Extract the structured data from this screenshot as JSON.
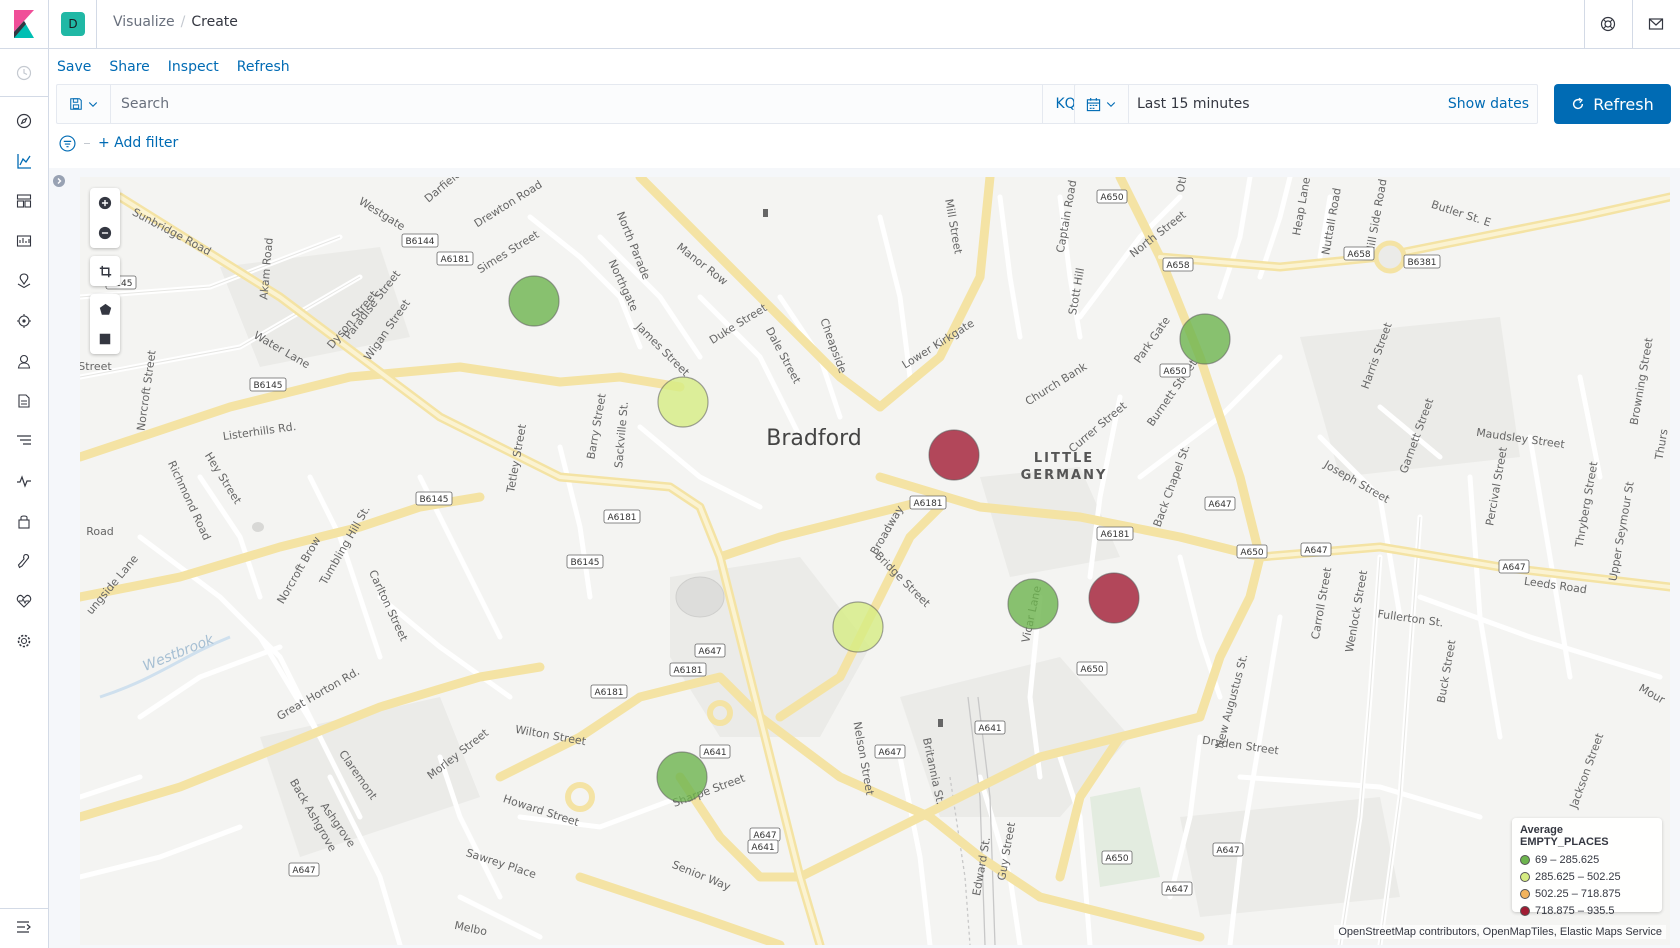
{
  "header": {
    "space_initial": "D",
    "breadcrumbs": [
      "Visualize",
      "Create"
    ]
  },
  "topmenu": {
    "save": "Save",
    "share": "Share",
    "inspect": "Inspect",
    "refresh": "Refresh"
  },
  "query": {
    "placeholder": "Search",
    "language": "KQL"
  },
  "time": {
    "label": "Last 15 minutes",
    "show_dates": "Show dates",
    "refresh_button": "Refresh"
  },
  "filter": {
    "add_filter": "+ Add filter"
  },
  "map": {
    "city_label": "Bradford",
    "district_label_line1": "LITTLE",
    "district_label_line2": "GERMANY",
    "area_label": "Westbrook",
    "street_labels": [
      "Sunbridge Road",
      "Westgate",
      "Drewton Road",
      "Darfield",
      "Simes Street",
      "North Parade",
      "Manor Row",
      "Northgate",
      "Duke Street",
      "Dale Street",
      "Cheapside",
      "James Street",
      "Barry Street",
      "Sackville St.",
      "Lower Kirkgate",
      "Church Bank",
      "Currer Street",
      "Burnett Street",
      "Park Gate",
      "North Street",
      "Captain Road",
      "Stott Hill",
      "Mill Street",
      "Heap Lane",
      "Nuttall Road",
      "Hill Side Road",
      "Butler St. E",
      "Harris Street",
      "Garnett Street",
      "Maudsley Street",
      "Browning Street",
      "Joseph Street",
      "Percival Street",
      "Thryberg Street",
      "Upper Seymour St",
      "Leeds Road",
      "Fullerton St.",
      "Buck Street",
      "Carroll Street",
      "Wenlock Street",
      "New Augustus St.",
      "Back Chapel St.",
      "Vicar Lane",
      "Bridge Street",
      "Broadway",
      "Dryden Street",
      "Jackson Street",
      "Nelson Street",
      "Britannia St.",
      "Edward St.",
      "Guy Street",
      "Senior Way",
      "Sharpe Street",
      "Howard Street",
      "Sawrey Place",
      "Wilton Street",
      "Morley Street",
      "Great Horton Rd.",
      "Claremont",
      "Back Ashgrove",
      "Ashgrove",
      "Carlton Street",
      "Norcroft Brow",
      "Tumbling Hill St.",
      "Listerhills Rd.",
      "Hey Street",
      "Richmond Road",
      "Norcroft Street",
      "Water Lane",
      "Tetley Street",
      "Dyson Street",
      "Paradise Street",
      "Wigan Street",
      "Akam Road",
      "Thurs",
      "Mour",
      "Road",
      "ungside Lane",
      "Melbo",
      "Street",
      "Otl"
    ],
    "road_shields": [
      "A650",
      "A658",
      "A658",
      "B6381",
      "A650",
      "A647",
      "A6181",
      "A650",
      "A647",
      "A647",
      "A6181",
      "A6181",
      "A6181",
      "A6181",
      "B6145",
      "B6145",
      "B6145",
      "B6144",
      "A6181",
      "A647",
      "A641",
      "A647",
      "A641",
      "A647",
      "A650",
      "A641",
      "A647",
      "A647",
      "A650",
      "A647",
      "6145"
    ]
  },
  "legend": {
    "title": "Average EMPTY_PLACES",
    "items": [
      {
        "label": "69 – 285.625",
        "color": "#6db44e"
      },
      {
        "label": "285.625 – 502.25",
        "color": "#d6ec82"
      },
      {
        "label": "502.25 – 718.875",
        "color": "#f2b35c"
      },
      {
        "label": "718.875 – 935.5",
        "color": "#a11c33"
      }
    ]
  },
  "points": [
    {
      "range": 0,
      "color": "#6db44e"
    },
    {
      "range": 1,
      "color": "#d6ec82"
    },
    {
      "range": 3,
      "color": "#a11c33"
    },
    {
      "range": 0,
      "color": "#6db44e"
    },
    {
      "range": 0,
      "color": "#6db44e"
    },
    {
      "range": 3,
      "color": "#a11c33"
    },
    {
      "range": 1,
      "color": "#d6ec82"
    },
    {
      "range": 0,
      "color": "#6db44e"
    }
  ],
  "attribution": "OpenStreetMap contributors, OpenMapTiles, Elastic Maps Service"
}
